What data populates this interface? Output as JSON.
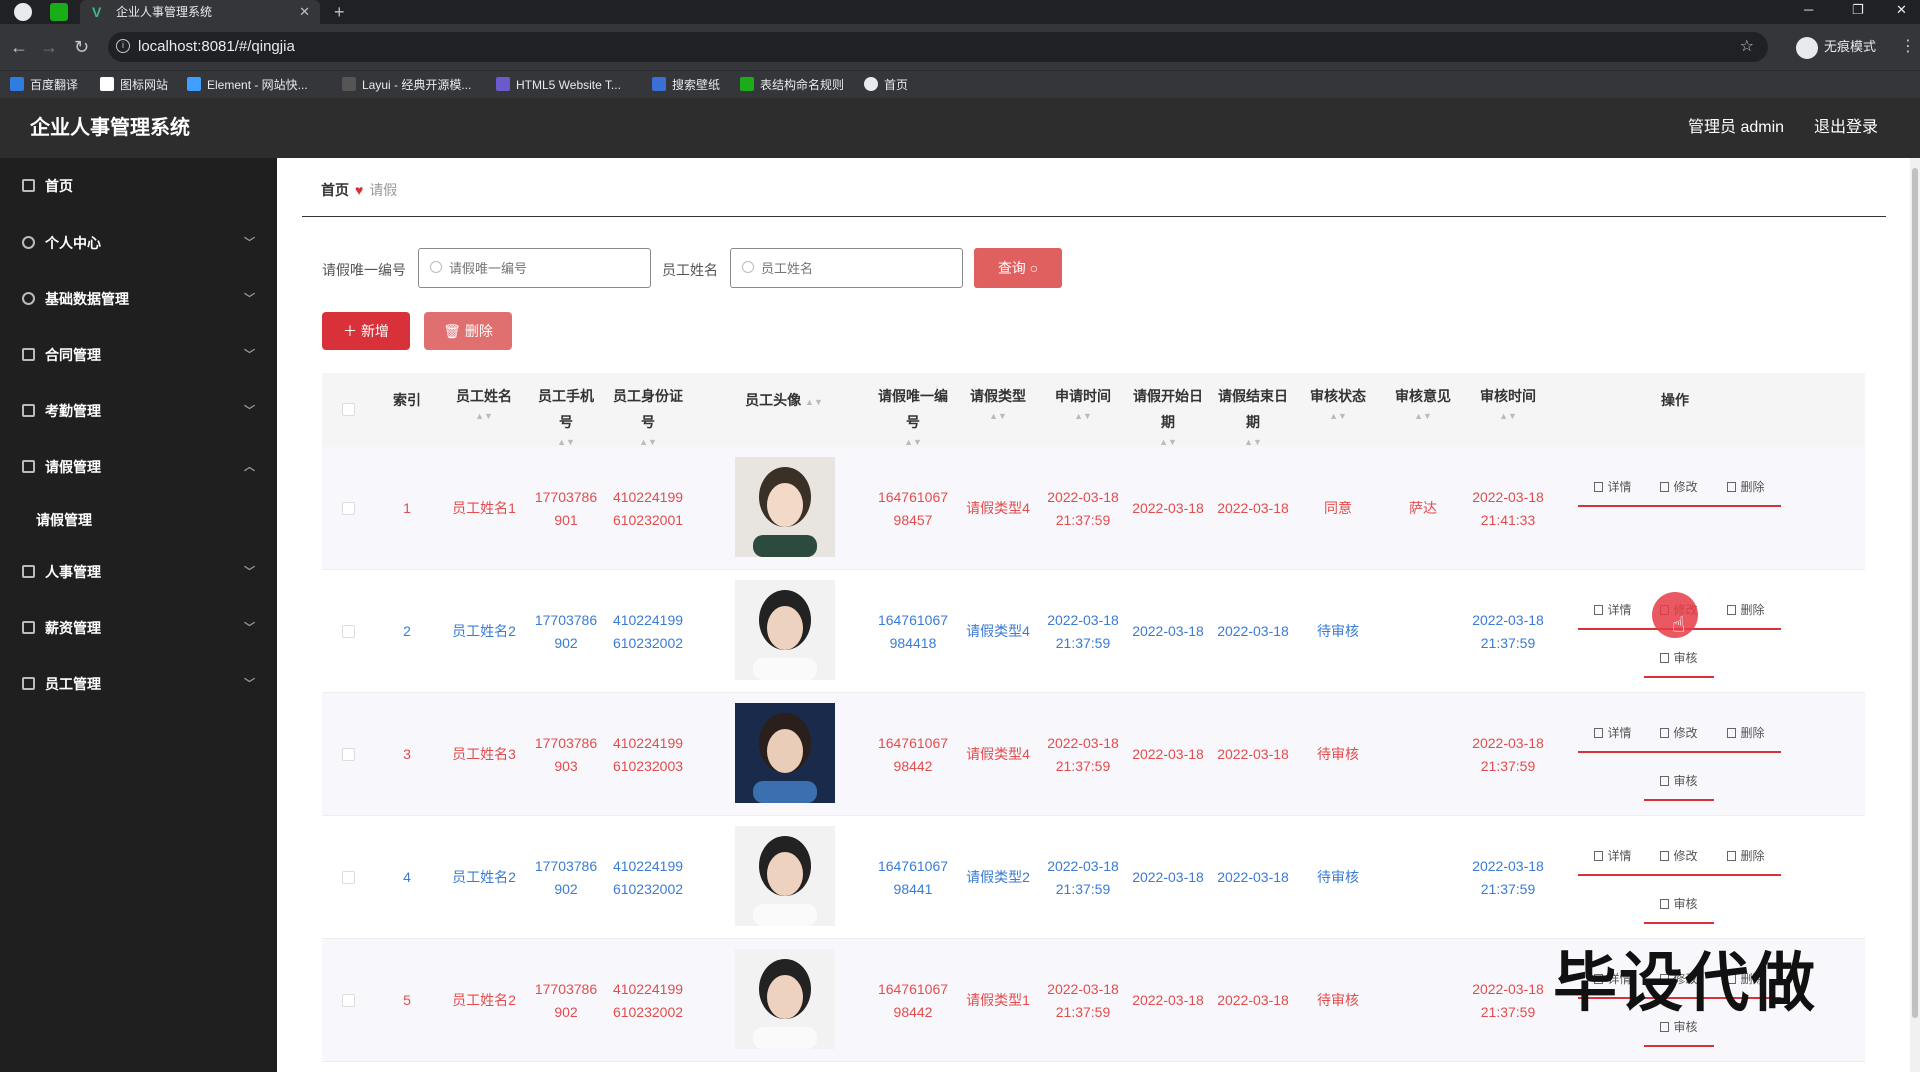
{
  "browser": {
    "tab_title": "企业人事管理系统",
    "url": "localhost:8081/#/qingjia",
    "profile_label": "无痕模式",
    "bookmarks": [
      "百度翻译",
      "图标网站",
      "Element - 网站快...",
      "Layui - 经典开源模...",
      "HTML5 Website T...",
      "搜索壁纸",
      "表结构命名规则",
      "首页"
    ]
  },
  "header": {
    "title": "企业人事管理系统",
    "admin_label": "管理员 admin",
    "logout": "退出登录"
  },
  "sidebar": {
    "items": [
      {
        "label": "首页",
        "icon": "home-icon"
      },
      {
        "label": "个人中心",
        "icon": "user-icon"
      },
      {
        "label": "基础数据管理",
        "icon": "user-icon"
      },
      {
        "label": "合同管理",
        "icon": "document-icon"
      },
      {
        "label": "考勤管理",
        "icon": "scan-icon"
      },
      {
        "label": "请假管理",
        "icon": "copy-icon"
      },
      {
        "label": "人事管理",
        "icon": "list-icon"
      },
      {
        "label": "薪资管理",
        "icon": "wallet-icon"
      },
      {
        "label": "员工管理",
        "icon": "card-icon"
      }
    ],
    "sub_item": "请假管理"
  },
  "breadcrumb": {
    "home": "首页",
    "current": "请假"
  },
  "search": {
    "label1": "请假唯一编号",
    "placeholder1": "请假唯一编号",
    "label2": "员工姓名",
    "placeholder2": "员工姓名",
    "query_button": "查询"
  },
  "actions": {
    "add": "新增",
    "delete": "删除"
  },
  "table": {
    "headers": {
      "index": "索引",
      "name": "员工姓名",
      "phone": "员工手机号",
      "idcard": "员工身份证号",
      "avatar": "员工头像",
      "leave_no": "请假唯一编号",
      "leave_type": "请假类型",
      "apply_time": "申请时间",
      "start_date": "请假开始日期",
      "end_date": "请假结束日期",
      "status": "审核状态",
      "opinion": "审核意见",
      "review_time": "审核时间",
      "ops": "操作"
    },
    "op_labels": {
      "detail": "详情",
      "edit": "修改",
      "delete": "删除",
      "review": "审核"
    },
    "rows": [
      {
        "index": "1",
        "name": "员工姓名1",
        "phone": "17703786901",
        "idcard": "410224199610232001",
        "leave_no": "16476106798457",
        "leave_type": "请假类型4",
        "apply_time": "2022-03-18 21:37:59",
        "start_date": "2022-03-18",
        "end_date": "2022-03-18",
        "status": "同意",
        "opinion": "萨达",
        "review_time": "2022-03-18 21:41:33",
        "color": "red",
        "has_review": false
      },
      {
        "index": "2",
        "name": "员工姓名2",
        "phone": "17703786902",
        "idcard": "410224199610232002",
        "leave_no": "164761067984418",
        "leave_type": "请假类型4",
        "apply_time": "2022-03-18 21:37:59",
        "start_date": "2022-03-18",
        "end_date": "2022-03-18",
        "status": "待审核",
        "opinion": "",
        "review_time": "2022-03-18 21:37:59",
        "color": "blue",
        "has_review": true
      },
      {
        "index": "3",
        "name": "员工姓名3",
        "phone": "17703786903",
        "idcard": "410224199610232003",
        "leave_no": "16476106798442",
        "leave_type": "请假类型4",
        "apply_time": "2022-03-18 21:37:59",
        "start_date": "2022-03-18",
        "end_date": "2022-03-18",
        "status": "待审核",
        "opinion": "",
        "review_time": "2022-03-18 21:37:59",
        "color": "red",
        "has_review": true
      },
      {
        "index": "4",
        "name": "员工姓名2",
        "phone": "17703786902",
        "idcard": "410224199610232002",
        "leave_no": "16476106798441",
        "leave_type": "请假类型2",
        "apply_time": "2022-03-18 21:37:59",
        "start_date": "2022-03-18",
        "end_date": "2022-03-18",
        "status": "待审核",
        "opinion": "",
        "review_time": "2022-03-18 21:37:59",
        "color": "blue",
        "has_review": true
      },
      {
        "index": "5",
        "name": "员工姓名2",
        "phone": "17703786902",
        "idcard": "410224199610232002",
        "leave_no": "16476106798442",
        "leave_type": "请假类型1",
        "apply_time": "2022-03-18 21:37:59",
        "start_date": "2022-03-18",
        "end_date": "2022-03-18",
        "status": "待审核",
        "opinion": "",
        "review_time": "2022-03-18 21:37:59",
        "color": "red",
        "has_review": true
      }
    ]
  },
  "watermark": "毕设代做",
  "colors": {
    "accent": "#d9313a",
    "row_red": "#e34c4c",
    "row_blue": "#3a7bd5"
  }
}
